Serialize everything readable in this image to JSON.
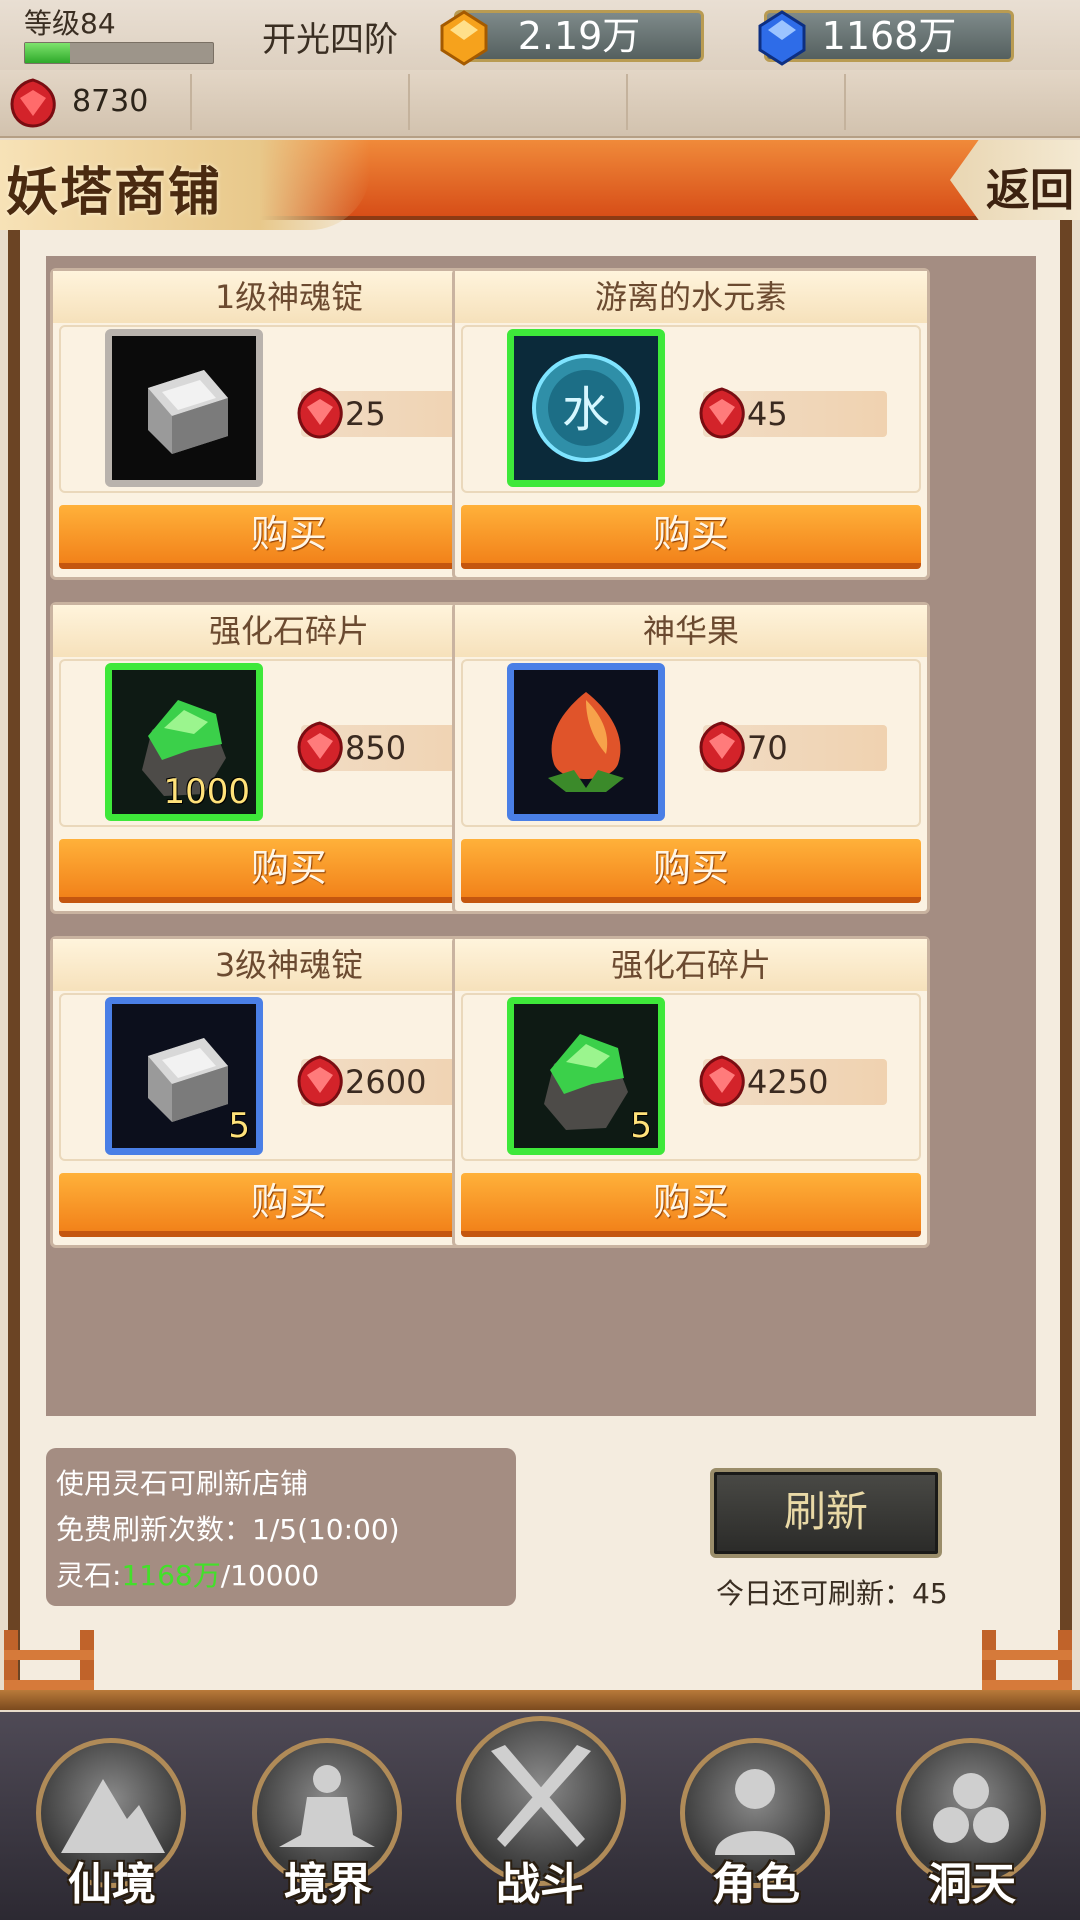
{
  "status": {
    "level": "等级84",
    "level_progress": 0.24,
    "realm": "开光四阶",
    "gold": "2.19万",
    "jade": "1168万",
    "ruby": "8730"
  },
  "shop": {
    "title": "妖塔商铺",
    "back": "返回",
    "items": [
      {
        "name": "1级神魂锭",
        "price": "25",
        "qty": "",
        "frame": "gray",
        "icon": "ingot-icon"
      },
      {
        "name": "游离的水元素",
        "price": "45",
        "qty": "",
        "frame": "green",
        "icon": "water-element-icon"
      },
      {
        "name": "强化石碎片",
        "price": "850",
        "qty": "1000",
        "frame": "green",
        "icon": "strengthen-stone-icon"
      },
      {
        "name": "神华果",
        "price": "70",
        "qty": "",
        "frame": "blue",
        "icon": "fruit-icon"
      },
      {
        "name": "3级神魂锭",
        "price": "2600",
        "qty": "5",
        "frame": "blue",
        "icon": "ingot-icon"
      },
      {
        "name": "强化石碎片",
        "price": "4250",
        "qty": "5",
        "frame": "green",
        "icon": "strengthen-stone-icon"
      }
    ],
    "buy_label": "购买",
    "water_glyph": "水"
  },
  "info": {
    "line1": "使用灵石可刷新店铺",
    "line2": "免费刷新次数：1/5(10:00)",
    "line3_prefix": "灵石:",
    "line3_value": "1168万",
    "line3_suffix": "/10000"
  },
  "refresh": {
    "label": "刷新",
    "remaining": "今日还可刷新：45"
  },
  "nav": {
    "items": [
      {
        "label": "仙境",
        "icon": "mountain-icon"
      },
      {
        "label": "境界",
        "icon": "meditation-icon"
      },
      {
        "label": "战斗",
        "icon": "crossed-swords-icon"
      },
      {
        "label": "角色",
        "icon": "character-icon"
      },
      {
        "label": "洞天",
        "icon": "triskelion-icon"
      }
    ]
  },
  "colors": {
    "accent_orange": "#f2821a",
    "frame_green": "#3ee83a",
    "frame_blue": "#4a7fe6",
    "frame_gray": "#b9b3ad"
  }
}
